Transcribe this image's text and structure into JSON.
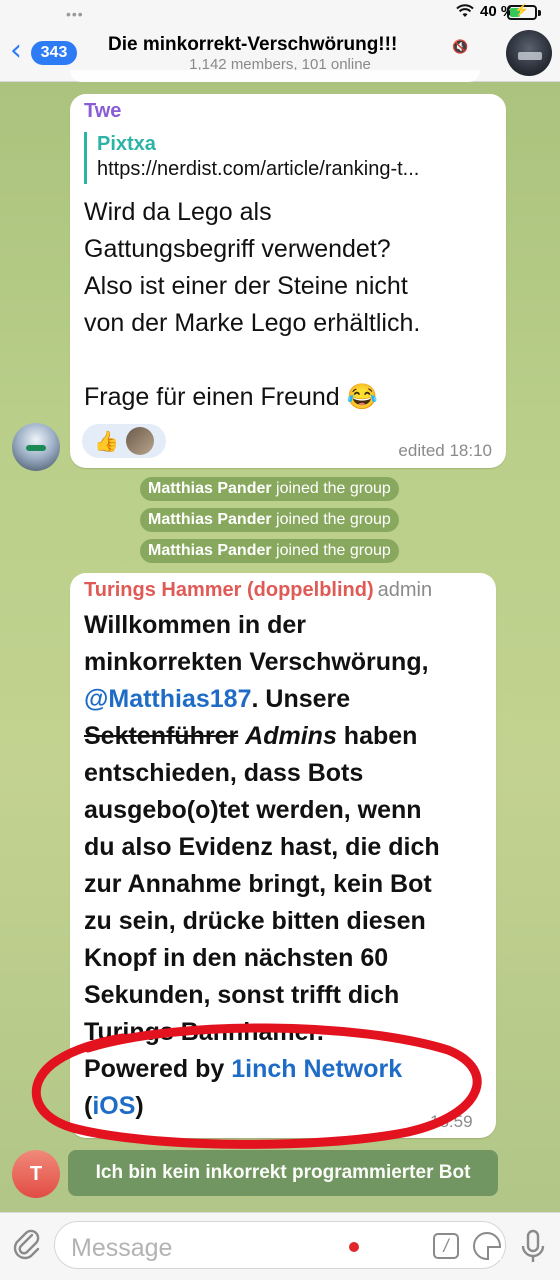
{
  "status": {
    "dots": "•••",
    "battery": "40 %"
  },
  "header": {
    "back_count": "343",
    "title": "Die minkorrekt-Verschwörung!!!",
    "subtitle": "1,142 members, 101 online"
  },
  "messages": {
    "m1": {
      "sender": "Twe",
      "reply_name": "Pixtxa",
      "reply_text": "https://nerdist.com/article/ranking-t...",
      "lines": [
        "Wird da Lego als",
        "Gattungsbegriff verwendet?",
        "Also ist einer der Steine nicht",
        "von der Marke Lego erhältlich.",
        "",
        "Frage für einen Freund 😂"
      ],
      "time": "edited 18:10"
    },
    "system": [
      {
        "name": "Matthias Pander",
        "text": "joined the group"
      },
      {
        "name": "Matthias Pander",
        "text": "joined the group"
      },
      {
        "name": "Matthias Pander",
        "text": "joined the group"
      }
    ],
    "m2": {
      "sender": "Turings Hammer (doppelblind)",
      "role": "admin",
      "l1": "Willkommen in der",
      "l2": "minkorrekten Verschwörung,",
      "mention": "@Matthias187",
      "l3_rest": ". Unsere",
      "strike": "Sektenführer",
      "italic": "Admins",
      "l4_rest": " haben",
      "l5": "entschieden, dass Bots",
      "l6": "ausgebo(o)tet werden, wenn",
      "l7": "du also Evidenz hast, die dich",
      "l8": "zur Annahme bringt, kein Bot",
      "l9": "zu sein, drücke bitten diesen",
      "l10": "Knopf in den nächsten 60",
      "l11": "Sekunden, sonst trifft dich",
      "l12": "Turings Bannhamer.",
      "powered": "Powered by ",
      "powered_link": "1inch Network",
      "ios_open": "(",
      "ios_link": "iOS",
      "ios_close": ")",
      "time": "18:59"
    },
    "bot_button": "Ich bin kein inkorrekt programmierter Bot",
    "bot_avatar_letter": "T"
  },
  "input": {
    "placeholder": "Message"
  },
  "colors": {
    "accent": "#2d7cf6",
    "annotation": "#e3121f"
  }
}
